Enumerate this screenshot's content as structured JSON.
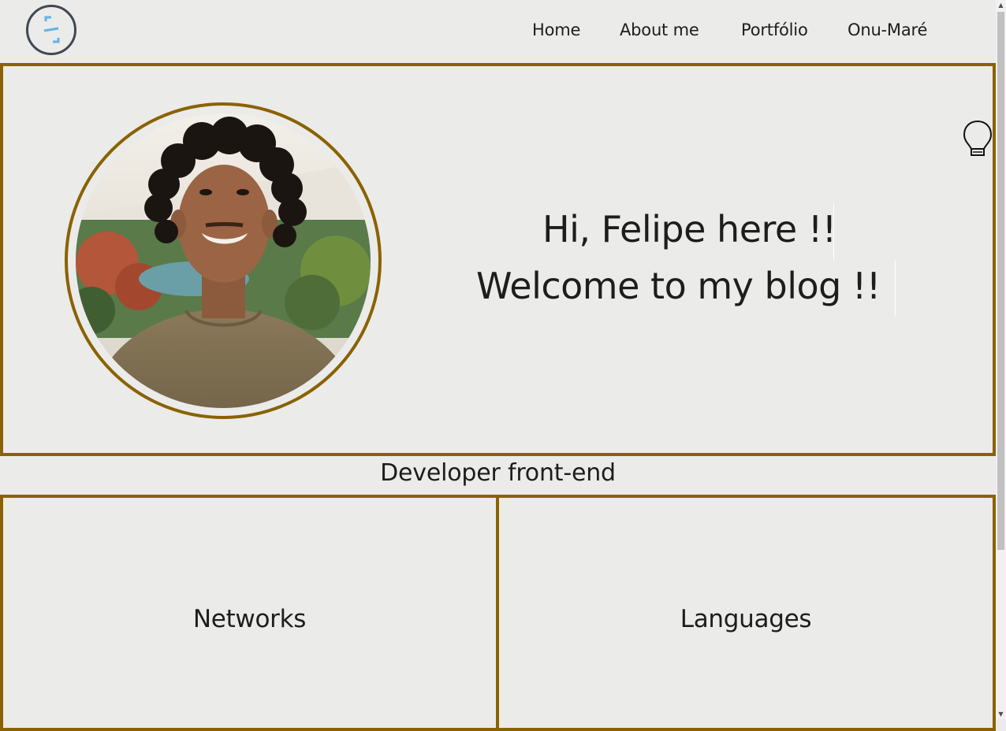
{
  "header": {
    "nav": [
      "Home",
      "About me",
      "Portfólio",
      "Onu-Maré"
    ]
  },
  "hero": {
    "line1": "Hi, Felipe here !!",
    "line2": "Welcome to my blog !!"
  },
  "subtitle": "Developer front-end",
  "cards": [
    "Networks",
    "Languages"
  ],
  "colors": {
    "accent": "#8a6200",
    "background": "#ebebe9",
    "text": "#1d1d1d",
    "logo_ring": "#404852",
    "logo_mark": "#5fb3e8"
  },
  "icons": {
    "logo": "code-slash-logo-icon",
    "theme_toggle": "lightbulb-icon"
  }
}
